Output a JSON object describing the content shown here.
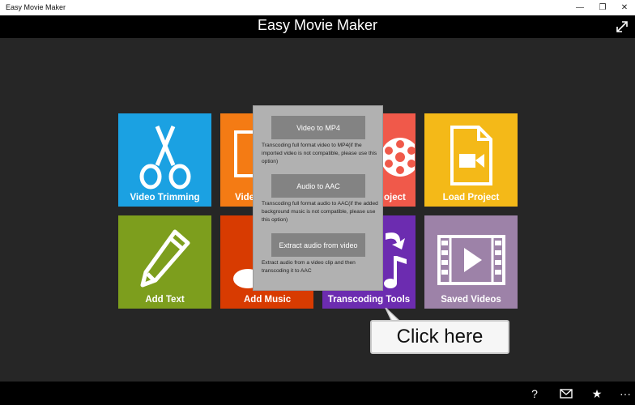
{
  "window": {
    "title": "Easy Movie Maker",
    "minimize_glyph": "—",
    "restore_glyph": "❐",
    "close_glyph": "✕"
  },
  "app": {
    "title": "Easy Movie Maker",
    "expand_icon": "expand-icon"
  },
  "tiles": [
    {
      "label": "Video Trimming",
      "color": "#1ba1e2",
      "icon": "scissors-icon"
    },
    {
      "label": "Video",
      "color": "#f47b14",
      "icon": "document-icon"
    },
    {
      "label": "oject",
      "color": "#f0594a",
      "icon": "film-reel-icon"
    },
    {
      "label": "Load Project",
      "color": "#f4b918",
      "icon": "video-file-icon"
    },
    {
      "label": "Add Text",
      "color": "#7d9e1d",
      "icon": "pencil-icon"
    },
    {
      "label": "Add Music",
      "color": "#d83b01",
      "icon": "music-icon"
    },
    {
      "label": "Transcoding Tools",
      "color": "#6c2cb0",
      "icon": "transcode-icon"
    },
    {
      "label": "Saved Videos",
      "color": "#9d82a8",
      "icon": "filmstrip-play-icon"
    }
  ],
  "popup": {
    "options": [
      {
        "button": "Video to MP4",
        "description": "Transcoding full format video to MP4(if the imported video is not compatible, please use this option)"
      },
      {
        "button": "Audio to AAC",
        "description": "Transcoding full format audio  to AAC(if the added background music is not compatible, please use this option)"
      },
      {
        "button": "Extract audio from video",
        "description": "Extract audio from a video clip and then transcoding it to AAC"
      }
    ],
    "background": "#b1b1b1",
    "button_color": "#838383"
  },
  "callout": {
    "text": "Click here"
  },
  "bottom_bar": {
    "help": "?",
    "mail_icon": "mail-icon",
    "star": "★",
    "more": "···"
  }
}
